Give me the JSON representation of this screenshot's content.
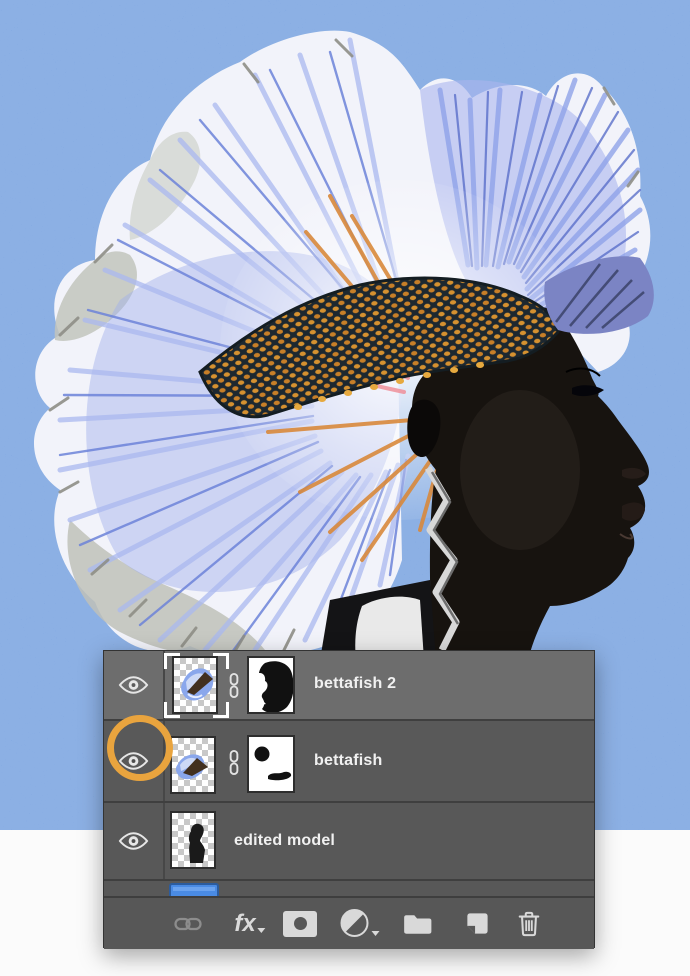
{
  "artwork": {
    "description": "model portrait with blue betta-fish fin mohawk on blue speckled background",
    "background_blue": "#5b8ed9",
    "floor_white": "#fbfbfb",
    "fin_periwinkle": "#aab6ef",
    "fin_deep_blue": "#6c82d8",
    "scale_orange": "#db9434",
    "skin_dark": "#17130f"
  },
  "layers_panel": {
    "layers": [
      {
        "name": "bettafish 2",
        "visible": true,
        "selected": true,
        "has_mask": true,
        "linked": true
      },
      {
        "name": "bettafish",
        "visible": true,
        "selected": false,
        "has_mask": true,
        "linked": true,
        "annotated_eye": true
      },
      {
        "name": "edited model",
        "visible": true,
        "selected": false,
        "has_mask": false,
        "linked": false
      }
    ],
    "partial_layer": {
      "thumb_color": "#4a8be4"
    },
    "fx_label": "fx",
    "toolbar_icons": [
      "link-icon",
      "fx-icon",
      "add-mask-icon",
      "adjustment-icon",
      "folder-icon",
      "new-layer-icon",
      "trash-icon"
    ],
    "colors": {
      "row_selected": "#6d6d6d",
      "row_normal": "#595959",
      "toolbar_bg": "#575757",
      "separator": "#3f3f3f",
      "label_text": "#f1f1f1",
      "annotation_ring": "#e9a43e",
      "icon_light": "#d9d9d9",
      "icon_dimmed": "#8d8d8d"
    }
  }
}
